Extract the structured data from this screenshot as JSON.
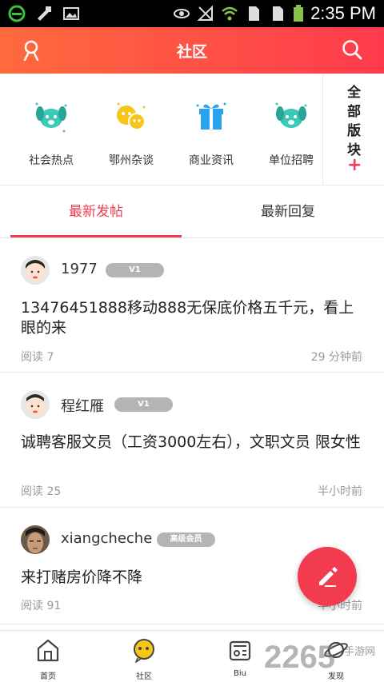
{
  "status_bar": {
    "time": "2:35 PM",
    "icons": [
      "e-browser-icon",
      "tools-icon",
      "image-icon",
      "eye-icon",
      "no-signal-icon",
      "wifi-icon",
      "sim-icon",
      "sim-icon",
      "battery-icon"
    ]
  },
  "header": {
    "title": "社区",
    "left_icon": "user-icon",
    "right_icon": "search-icon",
    "accent_color": "#f23b4f"
  },
  "categories": [
    {
      "label": "社会热点",
      "icon": "dog-icon"
    },
    {
      "label": "鄂州杂谈",
      "icon": "emoji-chat-icon"
    },
    {
      "label": "商业资讯",
      "icon": "gift-icon"
    },
    {
      "label": "单位招聘",
      "icon": "dog-icon"
    }
  ],
  "all_sections": {
    "label": "全部版块",
    "plus": "+"
  },
  "tabs": [
    {
      "label": "最新发帖",
      "active": true
    },
    {
      "label": "最新回复",
      "active": false
    }
  ],
  "posts": [
    {
      "username": "1977",
      "badge": "V1",
      "title": "13476451888移动888无保底价格五千元，看上眼的来",
      "reads": "阅读 7",
      "time": "29 分钟前"
    },
    {
      "username": "程红雁",
      "badge": "V1",
      "title": "诚聘客服文员（工资3000左右），文职文员 限女性",
      "reads": "阅读 25",
      "time": "半小时前"
    },
    {
      "username": "xiangcheche",
      "badge": "高级会员",
      "title": "来打赌房价降不降",
      "reads": "阅读 91",
      "time": "半小时前"
    }
  ],
  "fab": {
    "icon": "pencil-icon"
  },
  "bottom_nav": [
    {
      "label": "首页",
      "icon": "home-icon"
    },
    {
      "label": "社区",
      "icon": "community-icon"
    },
    {
      "label": "Biu",
      "icon": "biu-icon"
    },
    {
      "label": "发现",
      "icon": "planet-icon"
    }
  ],
  "watermark": {
    "text": "2265",
    "sub": "手游网"
  }
}
